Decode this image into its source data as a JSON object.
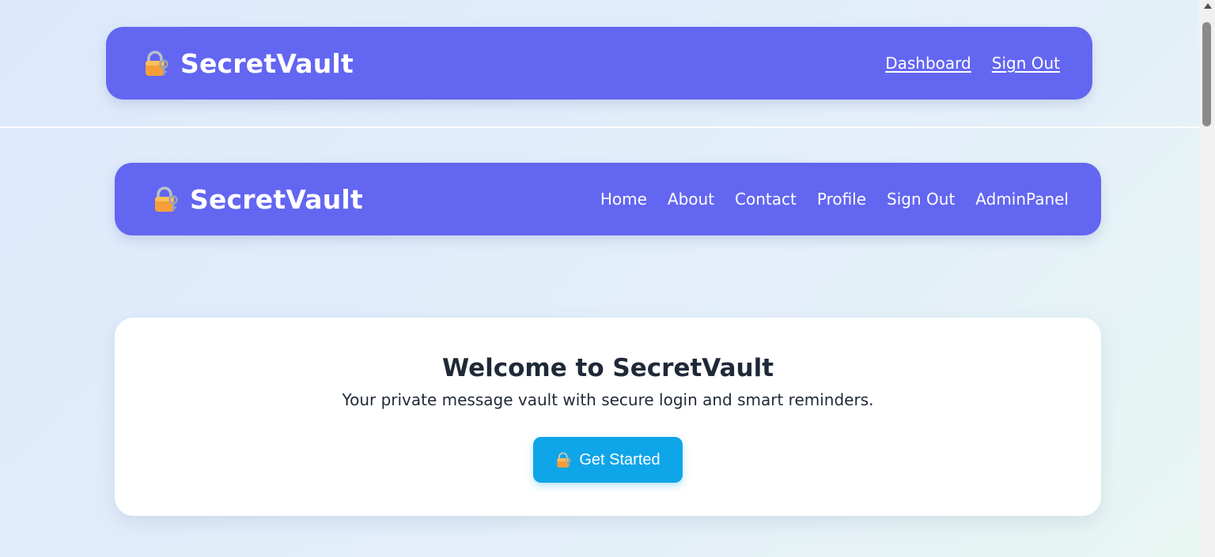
{
  "colors": {
    "navbar": "#6366f1",
    "cta": "#0ea5e9",
    "card": "#ffffff",
    "title_text": "#1f2937"
  },
  "brand": {
    "icon": "lock-with-key-icon",
    "name": "SecretVault"
  },
  "top_nav": {
    "links": [
      "Dashboard",
      "Sign Out"
    ]
  },
  "main_nav": {
    "links": [
      "Home",
      "About",
      "Contact",
      "Profile",
      "Sign Out",
      "AdminPanel"
    ]
  },
  "hero": {
    "title": "Welcome to SecretVault",
    "subtitle": "Your private message vault with secure login and smart reminders.",
    "cta_icon": "lock-with-key-icon",
    "cta_label": "Get Started"
  }
}
